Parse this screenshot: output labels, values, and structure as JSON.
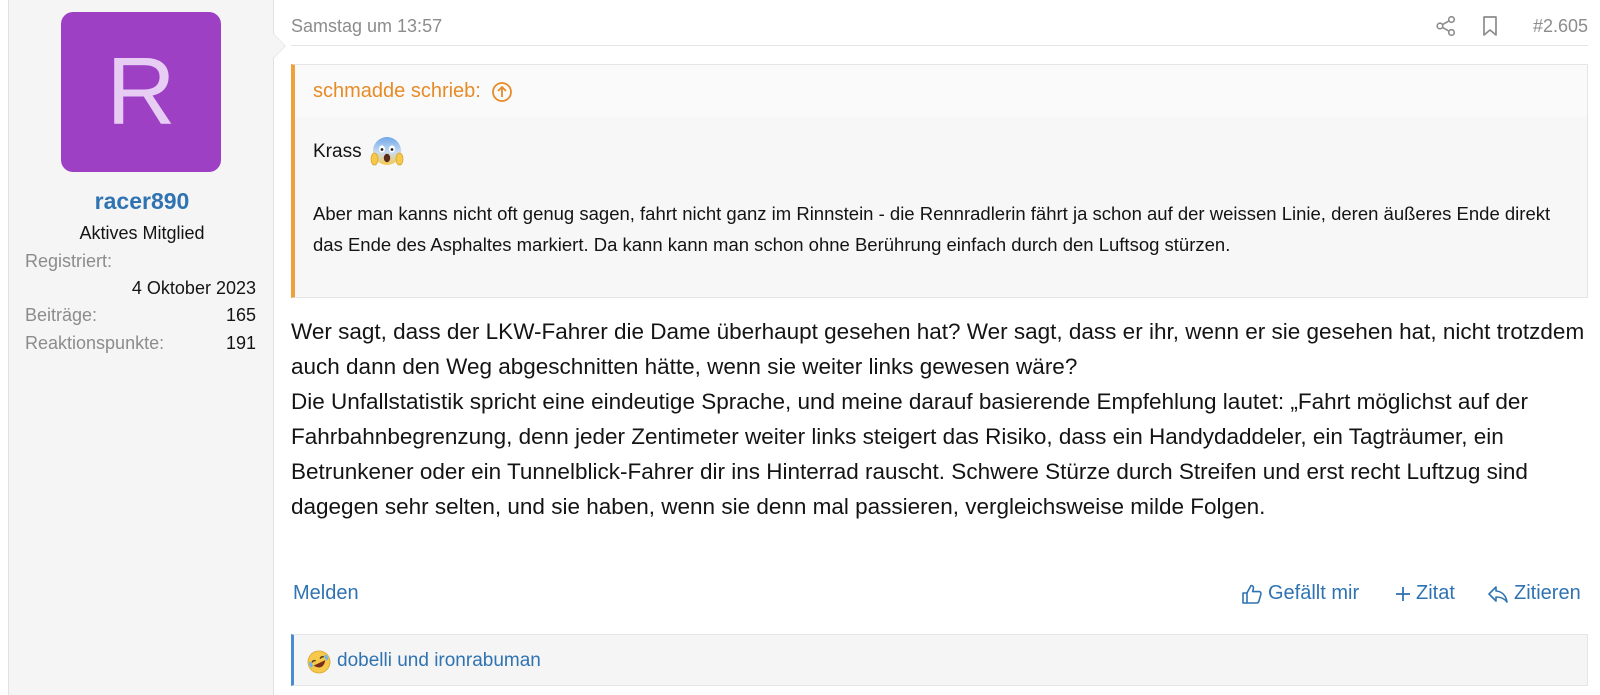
{
  "user": {
    "avatar_letter": "R",
    "avatar_color": "#9d40c4",
    "username": "racer890",
    "title": "Aktives Mitglied",
    "registered_label": "Registriert:",
    "registered_value": "4 Oktober 2023",
    "posts_label": "Beiträge:",
    "posts_value": "165",
    "reactions_label": "Reaktionspunkte:",
    "reactions_value": "191"
  },
  "post": {
    "date": "Samstag um 13:57",
    "number": "#2.605",
    "icons": {
      "share": "share-icon",
      "bookmark": "bookmark-icon"
    }
  },
  "quote": {
    "author": "schmadde schrieb:",
    "jump_icon": "arrow-up-circle-icon",
    "line1": "Krass",
    "emoji": "screaming-face-emoji",
    "paragraph": "Aber man kanns nicht oft genug sagen, fahrt nicht ganz im Rinnstein - die Rennradlerin fährt ja schon auf der weissen Linie, deren äußeres Ende direkt das Ende des Asphaltes markiert. Da kann kann man schon ohne Berührung einfach durch den Luftsog stürzen.",
    "accent_color": "#f0a13d"
  },
  "message": {
    "para1": "Wer sagt, dass der LKW-Fahrer die Dame überhaupt gesehen hat? Wer sagt, dass er ihr, wenn er sie gesehen hat, nicht trotzdem auch dann den Weg abgeschnitten hätte, wenn sie weiter links gewesen wäre?",
    "para2": "Die Unfallstatistik spricht eine eindeutige Sprache, und meine darauf basierende Empfehlung lautet: „Fahrt möglichst auf der Fahrbahnbegrenzung, denn jeder Zentimeter weiter links steigert das Risiko, dass ein Handydaddeler, ein Tagträumer, ein Betrunkener oder ein Tunnelblick-Fahrer dir ins Hinterrad rauscht. Schwere Stürze durch Streifen und erst recht Luftzug sind dagegen sehr selten, und sie haben, wenn sie denn mal passieren, vergleichsweise milde Folgen."
  },
  "actions": {
    "report": "Melden",
    "like": "Gefällt mir",
    "quote": "Zitat",
    "reply": "Zitieren",
    "link_color": "#2f73b2"
  },
  "reactions": {
    "emoji": "rolling-on-floor-laughing-emoji",
    "users": "dobelli und ironrabuman"
  }
}
